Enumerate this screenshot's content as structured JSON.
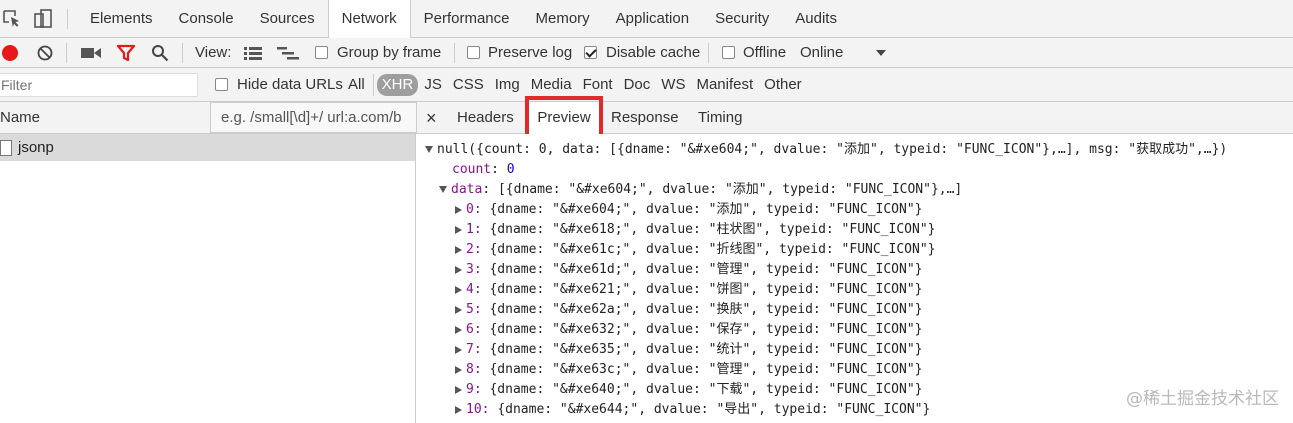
{
  "main_tabs": [
    "Elements",
    "Console",
    "Sources",
    "Network",
    "Performance",
    "Memory",
    "Application",
    "Security",
    "Audits"
  ],
  "toolbar": {
    "view_label": "View:",
    "group_by_frame": "Group by frame",
    "preserve_log": "Preserve log",
    "disable_cache": "Disable cache",
    "disable_cache_checked": true,
    "offline": "Offline",
    "throttle": "Online"
  },
  "filter": {
    "placeholder": "Filter",
    "hide_data_urls": "Hide data URLs",
    "types": [
      "All",
      "XHR",
      "JS",
      "CSS",
      "Img",
      "Media",
      "Font",
      "Doc",
      "WS",
      "Manifest",
      "Other"
    ],
    "active_type": "XHR"
  },
  "detail": {
    "name_header": "Name",
    "url_hint": "e.g. /small[\\d]+/ url:a.com/b",
    "close": "×",
    "tabs": [
      "Headers",
      "Preview",
      "Response",
      "Timing"
    ],
    "active_tab": "Preview"
  },
  "requests": [
    {
      "name": "jsonp"
    }
  ],
  "preview": {
    "root": "null({count: 0, data: [{dname: \"&#xe604;\", dvalue: \"添加\", typeid: \"FUNC_ICON\"},…], msg: \"获取成功\",…})",
    "count_key": "count",
    "count_value": "0",
    "data_key": "data",
    "data_summary": "[{dname: \"&#xe604;\", dvalue: \"添加\", typeid: \"FUNC_ICON\"},…]",
    "items": [
      {
        "index": "0",
        "text": "{dname: \"&#xe604;\", dvalue: \"添加\", typeid: \"FUNC_ICON\"}"
      },
      {
        "index": "1",
        "text": "{dname: \"&#xe618;\", dvalue: \"柱状图\", typeid: \"FUNC_ICON\"}"
      },
      {
        "index": "2",
        "text": "{dname: \"&#xe61c;\", dvalue: \"折线图\", typeid: \"FUNC_ICON\"}"
      },
      {
        "index": "3",
        "text": "{dname: \"&#xe61d;\", dvalue: \"管理\", typeid: \"FUNC_ICON\"}"
      },
      {
        "index": "4",
        "text": "{dname: \"&#xe621;\", dvalue: \"饼图\", typeid: \"FUNC_ICON\"}"
      },
      {
        "index": "5",
        "text": "{dname: \"&#xe62a;\", dvalue: \"换肤\", typeid: \"FUNC_ICON\"}"
      },
      {
        "index": "6",
        "text": "{dname: \"&#xe632;\", dvalue: \"保存\", typeid: \"FUNC_ICON\"}"
      },
      {
        "index": "7",
        "text": "{dname: \"&#xe635;\", dvalue: \"统计\", typeid: \"FUNC_ICON\"}"
      },
      {
        "index": "8",
        "text": "{dname: \"&#xe63c;\", dvalue: \"管理\", typeid: \"FUNC_ICON\"}"
      },
      {
        "index": "9",
        "text": "{dname: \"&#xe640;\", dvalue: \"下载\", typeid: \"FUNC_ICON\"}"
      },
      {
        "index": "10",
        "text": "{dname: \"&#xe644;\", dvalue: \"导出\", typeid: \"FUNC_ICON\"}"
      }
    ]
  },
  "watermark": "@稀土掘金技术社区",
  "colors": {
    "record": "#e61919",
    "filter_active": "#e61919",
    "highlight": "#e12b2b"
  }
}
